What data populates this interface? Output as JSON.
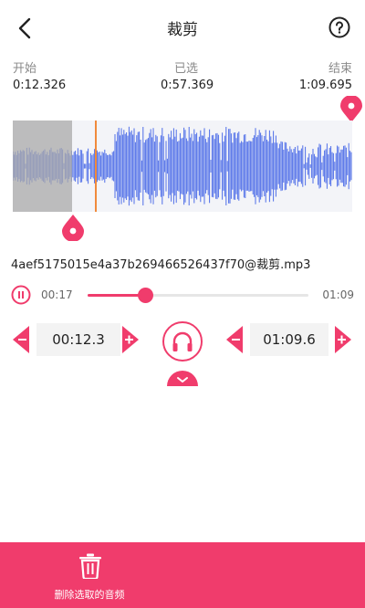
{
  "header": {
    "title": "裁剪"
  },
  "times": {
    "start_label": "开始",
    "start_value": "0:12.326",
    "selected_label": "已选",
    "selected_value": "0:57.369",
    "end_label": "结束",
    "end_value": "1:09.695"
  },
  "file": {
    "name": "4aef5175015e4a37b269466526437f70@裁剪.mp3"
  },
  "player": {
    "current": "00:17",
    "duration": "01:09",
    "progress": 0.26
  },
  "edit": {
    "start_time": "00:12.3",
    "end_time": "01:09.6"
  },
  "actions": {
    "delete_label": "删除选取的音频"
  },
  "colors": {
    "accent": "#f03c6c",
    "wave": "#4f6ee8",
    "selection": "#a9a9a9",
    "playhead": "#f08a3c"
  },
  "icons": [
    "back-icon",
    "help-icon",
    "pause-icon",
    "headphone-icon",
    "chevron-down-icon",
    "trash-icon"
  ]
}
